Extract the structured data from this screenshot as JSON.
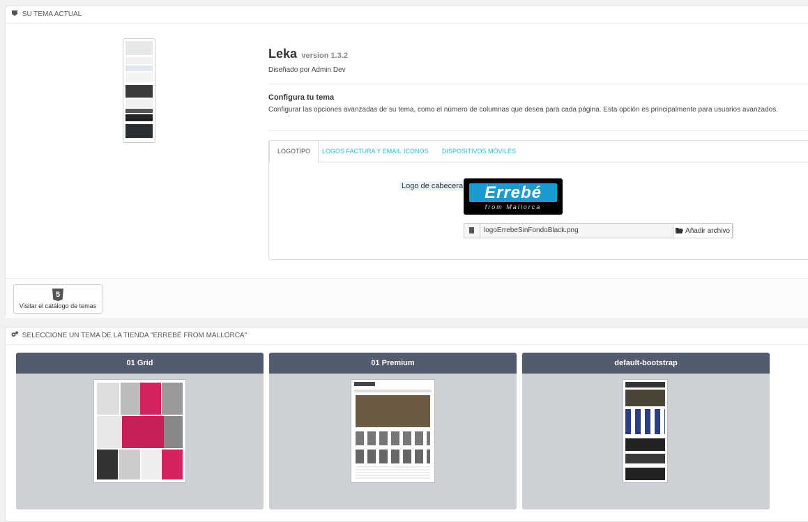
{
  "current_theme": {
    "header": "SU TEMA ACTUAL",
    "name": "Leka",
    "version": "version 1.3.2",
    "designed_by": "Diseñado por Admin Dev",
    "config_title": "Configura tu tema",
    "config_desc": "Configurar las opciones avanzadas de su tema, como el número de columnas que desea para cada página. Esta opción es principalmente para usuarios avanzados.",
    "tabs": [
      "LOGOTIPO",
      "LOGOS FACTURA Y EMAIL",
      "ICONOS",
      "DISPOSITIVOS MÓVILES"
    ],
    "active_tab": "LOGOTIPO",
    "logo_label": "Logo de cabecera",
    "logo_text": "Errebé",
    "logo_subtext": "from Mallorca",
    "file_name": "logoErrebeSinFondoBlack.png",
    "add_file_label": "Añadir archivo",
    "catalog_button": "Visitar el catálogo de temas",
    "html5_glyph": "5"
  },
  "themes": {
    "header": "SELECCIONE UN TEMA DE LA TIENDA \"ERREBÉ FROM MALLORCA\"",
    "cards": [
      {
        "title": "01 Grid"
      },
      {
        "title": "01 Premium"
      },
      {
        "title": "default-bootstrap"
      }
    ]
  },
  "icons": {
    "current_header": "shield-icon",
    "themes_header": "gears-icon",
    "file": "file-icon",
    "folder": "folder-open-icon",
    "catalog": "html5-icon"
  },
  "colors": {
    "accent": "#25b9d7",
    "card_header": "#535b6e",
    "card_body": "#cdd0d4",
    "logo_blue": "#1c9bd0"
  }
}
